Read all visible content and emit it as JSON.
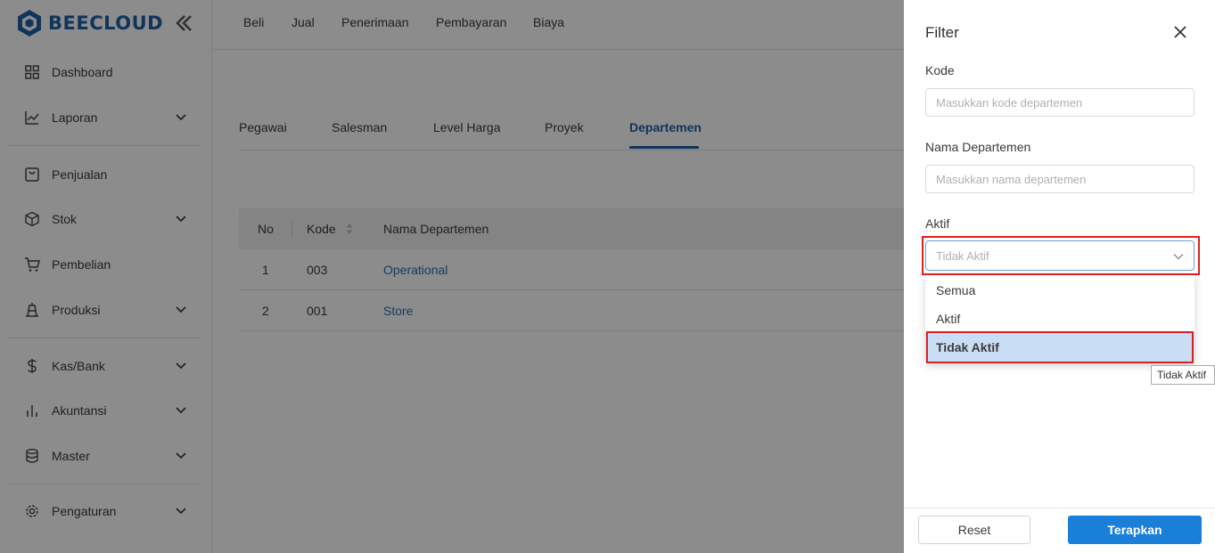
{
  "brand": {
    "name": "BEECLOUD",
    "color": "#1f5fa8"
  },
  "sidebar": {
    "items": [
      {
        "label": "Dashboard",
        "icon": "grid-icon",
        "expandable": false
      },
      {
        "label": "Laporan",
        "icon": "line-chart-icon",
        "expandable": true
      },
      {
        "label": "Penjualan",
        "icon": "shopping-bag-icon",
        "expandable": false
      },
      {
        "label": "Stok",
        "icon": "box-icon",
        "expandable": true
      },
      {
        "label": "Pembelian",
        "icon": "cart-icon",
        "expandable": false
      },
      {
        "label": "Produksi",
        "icon": "factory-icon",
        "expandable": true
      },
      {
        "label": "Kas/Bank",
        "icon": "dollar-icon",
        "expandable": true
      },
      {
        "label": "Akuntansi",
        "icon": "bar-chart-icon",
        "expandable": true
      },
      {
        "label": "Master",
        "icon": "database-icon",
        "expandable": true
      },
      {
        "label": "Pengaturan",
        "icon": "gear-icon",
        "expandable": true
      }
    ]
  },
  "topnav": [
    "Beli",
    "Jual",
    "Penerimaan",
    "Pembayaran",
    "Biaya"
  ],
  "tabs": {
    "items": [
      "Pegawai",
      "Salesman",
      "Level Harga",
      "Proyek",
      "Departemen"
    ],
    "active": "Departemen"
  },
  "table": {
    "columns": [
      "No",
      "Kode",
      "Nama Departemen"
    ],
    "rows": [
      {
        "no": "1",
        "kode": "003",
        "nama": "Operational"
      },
      {
        "no": "2",
        "kode": "001",
        "nama": "Store"
      }
    ]
  },
  "filter": {
    "title": "Filter",
    "kode_label": "Kode",
    "kode_placeholder": "Masukkan kode departemen",
    "nama_label": "Nama Departemen",
    "nama_placeholder": "Masukkan nama departemen",
    "aktif_label": "Aktif",
    "aktif_value": "Tidak Aktif",
    "options": [
      "Semua",
      "Aktif",
      "Tidak Aktif"
    ],
    "selected_option": "Tidak Aktif",
    "tooltip": "Tidak Aktif",
    "reset_label": "Reset",
    "apply_label": "Terapkan"
  },
  "colors": {
    "accent": "#1a7fd8",
    "link": "#2a6db3",
    "highlight": "#e02020",
    "selected_bg": "#c9def5"
  }
}
